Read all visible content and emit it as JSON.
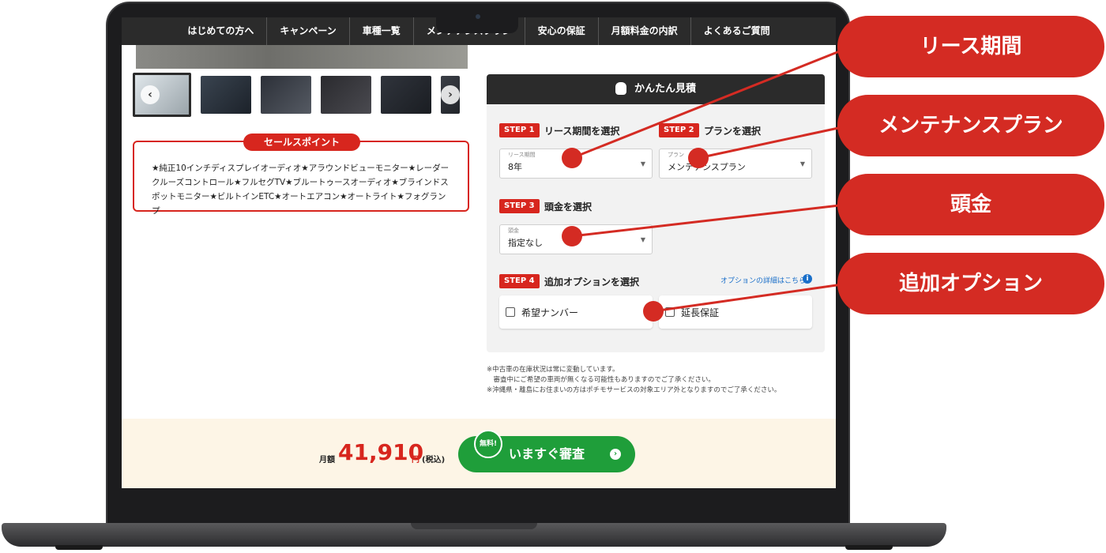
{
  "nav": {
    "items": [
      "はじめての方へ",
      "キャンペーン",
      "車種一覧",
      "メンテナンスプラン",
      "安心の保証",
      "月額料金の内訳",
      "よくあるご質問"
    ]
  },
  "sales": {
    "tag": "セールスポイント",
    "text": "★純正10インチディスプレイオーディオ★アラウンドビューモニター★レーダークルーズコントロール★フルセグTV★ブルートゥースオーディオ★ブラインドスポットモニター★ビルトインETC★オートエアコン★オートライト★フォグランプ"
  },
  "estimate": {
    "title": "かんたん見積",
    "step1": {
      "badge": "STEP 1",
      "label": "リース期間を選択",
      "caption": "リース期間",
      "value": "8年"
    },
    "step2": {
      "badge": "STEP 2",
      "label": "プランを選択",
      "caption": "プラン",
      "value": "メンテナンスプラン"
    },
    "step3": {
      "badge": "STEP 3",
      "label": "頭金を選択",
      "caption": "頭金",
      "value": "指定なし"
    },
    "step4": {
      "badge": "STEP 4",
      "label": "追加オプションを選択",
      "link": "オプションの詳細はこちら",
      "opt1": "希望ナンバー",
      "opt2": "延長保証"
    }
  },
  "notes": [
    "※中古車の在庫状況は常に変動しています。",
    "　審査中にご希望の車両が無くなる可能性もありますのでご了承ください。",
    "※沖縄県・離島にお住まいの方はポチモサービスの対象エリア外となりますのでご了承ください。"
  ],
  "price": {
    "prefix": "月額",
    "value": "41,910",
    "unit": "円",
    "tax": "(税込)"
  },
  "apply": {
    "label": "いますぐ審査",
    "badge": "無料!"
  },
  "callouts": [
    "リース期間",
    "メンテナンスプラン",
    "頭金",
    "追加オプション"
  ],
  "colors": {
    "accent": "#d42b23",
    "button": "#1f9e3a",
    "nav": "#2b2b2b"
  }
}
